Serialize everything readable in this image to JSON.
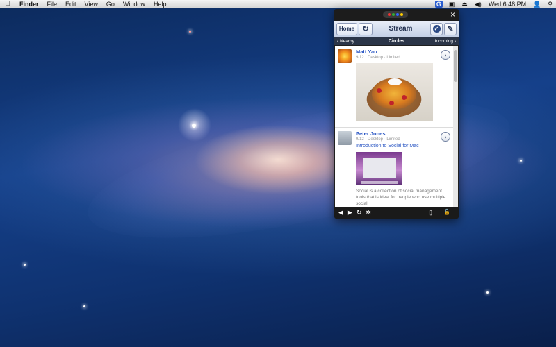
{
  "menubar": {
    "apple_icon": "",
    "items": [
      "Finder",
      "File",
      "Edit",
      "View",
      "Go",
      "Window",
      "Help"
    ],
    "clock": "Wed 6:48 PM",
    "tray_app_label": "G"
  },
  "app": {
    "toolbar": {
      "home_label": "Home",
      "refresh_icon": "↻",
      "title": "Stream",
      "check_icon": "✓",
      "compose_icon": "✎"
    },
    "subnav": {
      "left": "‹ Nearby",
      "center": "Circles",
      "right": "Incoming ›"
    },
    "posts": [
      {
        "author": "Matt Yau",
        "meta": "9/12 · Desktop · Limited",
        "has_photo": true
      },
      {
        "author": "Peter Jones",
        "meta": "9/12 · Desktop · Limited",
        "link": "Introduction to Social for Mac",
        "body": "Social is a collection of social management tools that is ideal for people who use multiple social"
      }
    ],
    "bottom": {
      "back_icon": "◀",
      "forward_icon": "▶",
      "reload_icon": "↻",
      "settings_icon": "✲",
      "device_icon": "▯",
      "lock_icon": "🔓"
    },
    "close_icon": "×"
  }
}
